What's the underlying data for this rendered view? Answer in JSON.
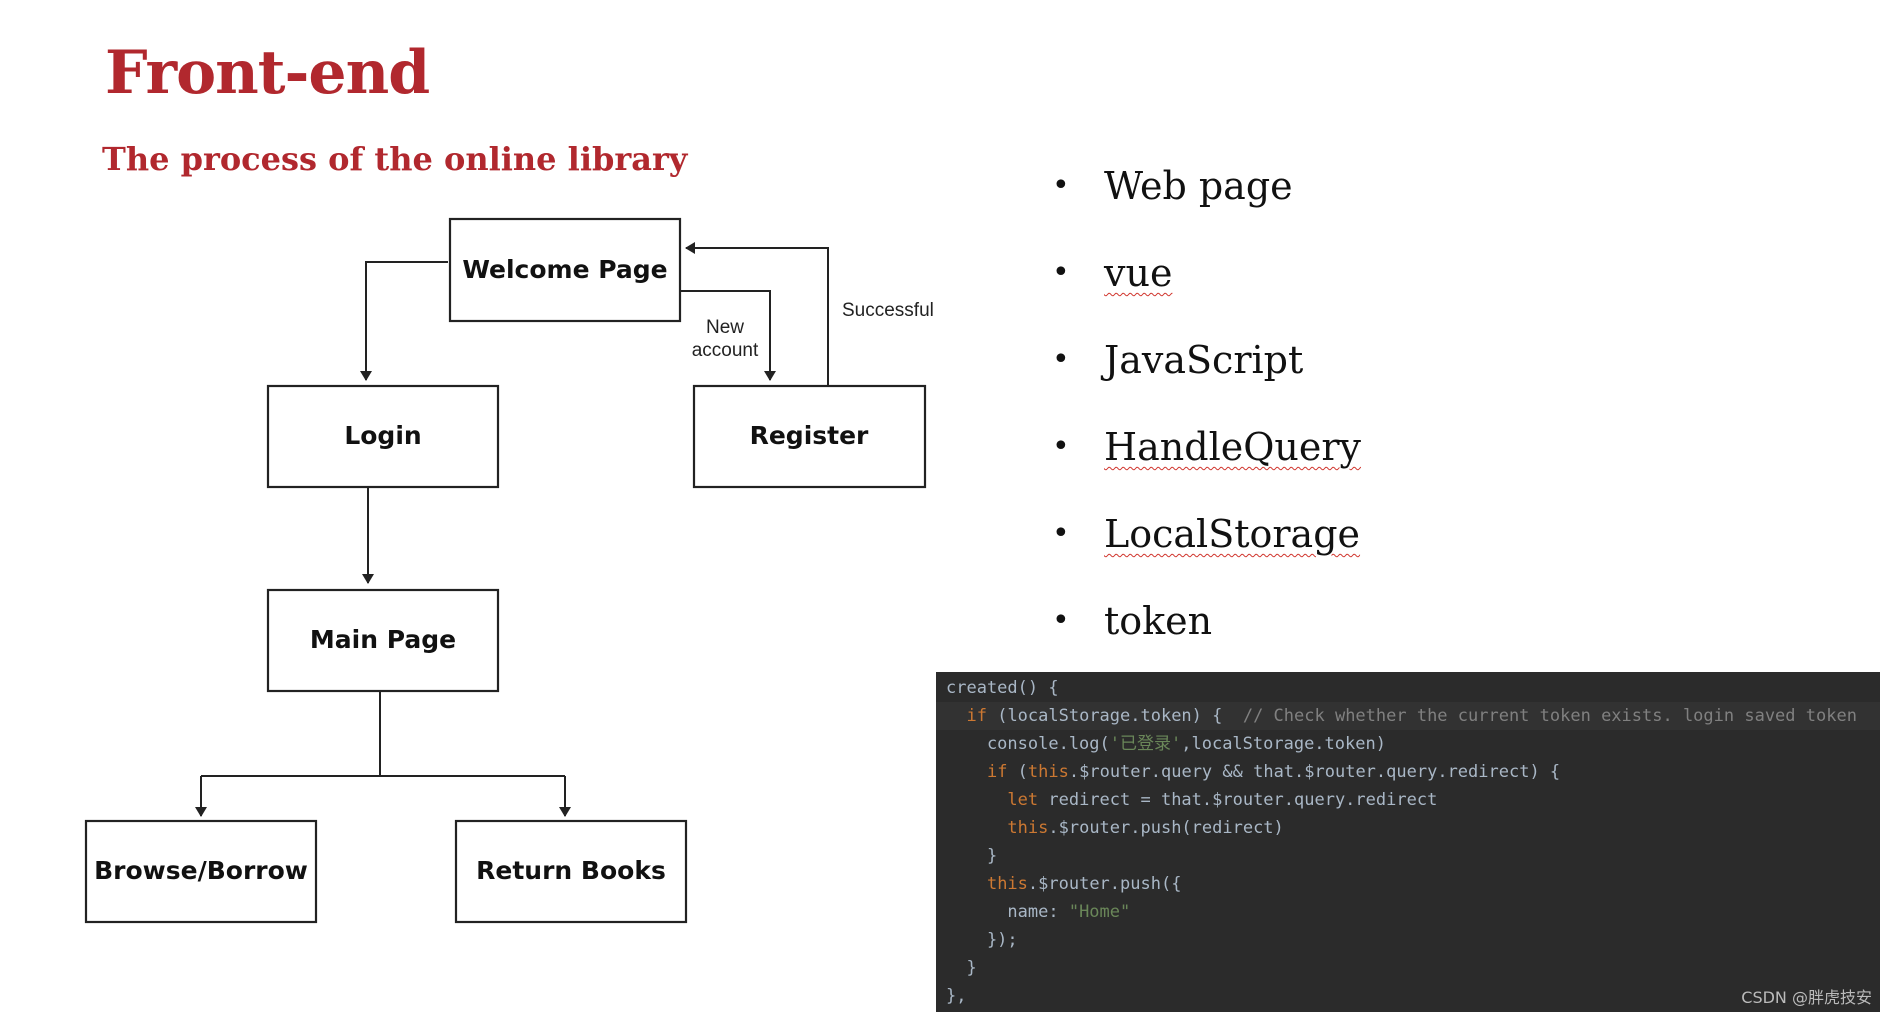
{
  "slide": {
    "title": "Front-end",
    "subtitle": "The process of the online library"
  },
  "flowchart": {
    "nodes": {
      "welcome": "Welcome Page",
      "login": "Login",
      "register": "Register",
      "main": "Main Page",
      "browse": "Browse/Borrow",
      "return": "Return Books"
    },
    "edge_labels": {
      "new_account_line1": "New",
      "new_account_line2": "account",
      "successful": "Successful"
    }
  },
  "bullets": [
    {
      "text": "Web page",
      "spellcheck": false
    },
    {
      "text": "vue",
      "spellcheck": true
    },
    {
      "text": "JavaScript",
      "spellcheck": false
    },
    {
      "text": "HandleQuery",
      "spellcheck": true
    },
    {
      "text": "LocalStorage",
      "spellcheck": true
    },
    {
      "text": "token",
      "spellcheck": false
    }
  ],
  "code": {
    "lines": [
      "created() {",
      "  if (localStorage.token) {  // Check whether the current token exists. login saved token",
      "    console.log('已登录',localStorage.token)",
      "    if (this.$router.query && that.$router.query.redirect) {",
      "      let redirect = that.$router.query.redirect",
      "      this.$router.push(redirect)",
      "    }",
      "    this.$router.push({",
      "      name: \"Home\"",
      "    });",
      "  }",
      "},"
    ],
    "watermark": "CSDN @胖虎技安"
  },
  "colors": {
    "title": "#b1282e",
    "code_background": "#2b2b2b",
    "keyword": "#cc7832",
    "string": "#6a8759",
    "comment": "#808080",
    "spellcheck_underline": "#d0342c"
  }
}
